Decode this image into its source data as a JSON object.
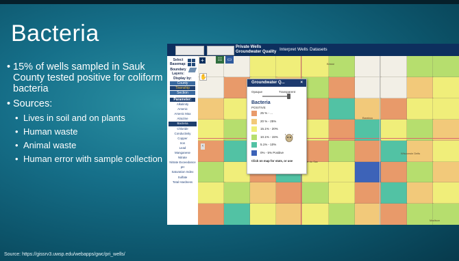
{
  "slide": {
    "title": "Bacteria",
    "bullets": [
      "15% of wells sampled in Sauk County tested positive for coliform bacteria",
      "Sources:"
    ],
    "sub_bullets": [
      "Lives in soil and on plants",
      "Human waste",
      "Animal waste",
      "Human error with sample collection"
    ],
    "source": "Source: https://gissrv3.uwsp.edu/webapps/gwc/pri_wells/"
  },
  "app": {
    "title_line1": "Private Wells",
    "title_line2": "Groundwater Quality",
    "nav": [
      "Interpret",
      "Wells",
      "Datasets"
    ],
    "sidebar": {
      "select_basemap": "Select Basemap:",
      "boundary_layers": "Boundary Layers:",
      "display_by": "Display by:",
      "display_options": [
        "County",
        "Township",
        "Section"
      ],
      "active_display": "Township",
      "parameter_head": "Parameter:",
      "parameters": [
        "Alkalinity",
        "Arsenic",
        "Arsenic Max",
        "Atrazine",
        "Bacteria",
        "Chloride",
        "Conductivity",
        "Copper",
        "Iron",
        "Lead",
        "Manganese",
        "Nitrate",
        "Nitrate Exceedance",
        "pH",
        "Saturation Index",
        "Sulfate",
        "Total Hardness"
      ],
      "active_parameter": "Bacteria"
    },
    "map": {
      "place_labels": [
        "Bristol",
        "Baraboo",
        "Madison",
        "Prairie du Sac",
        "Wisconsin Dells"
      ],
      "zoom_in": "+",
      "zoom_out": "−"
    },
    "legend_panel": {
      "title": "Groundwater Q...",
      "close": "×",
      "opaque": "Opaque",
      "transparent": "Transparent",
      "parameter": "Bacteria",
      "subtitle": "POSITIVE",
      "items": [
        {
          "label": "25 % - ...",
          "color": "#e89a6a"
        },
        {
          "label": "20 % - 25%",
          "color": "#f2c97a"
        },
        {
          "label": "15.1% - 20%",
          "color": "#f0ee7a"
        },
        {
          "label": "10.1% - 15%",
          "color": "#b6de6e"
        },
        {
          "label": "5.1% - 10%",
          "color": "#52c2a4"
        },
        {
          "label": "0% - 5% Positive",
          "color": "#3d63b8"
        }
      ],
      "note": "Click on map for stats, or use"
    }
  },
  "colors": {
    "header_navy": "#0d2f5e",
    "slide_teal": "#16708a"
  }
}
